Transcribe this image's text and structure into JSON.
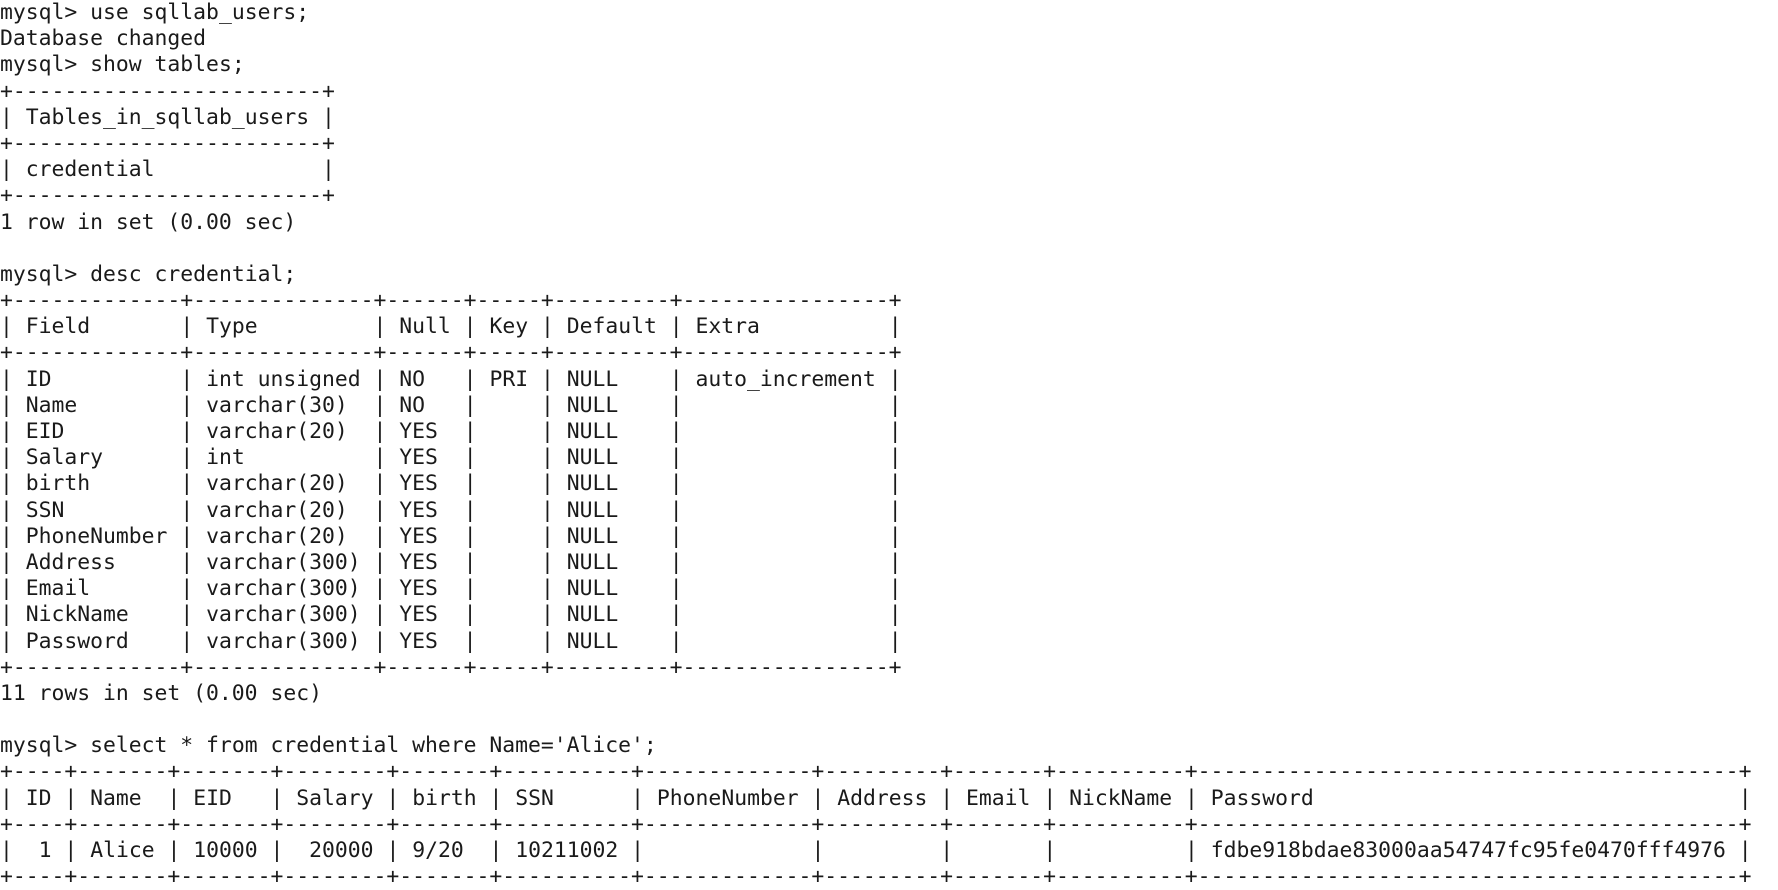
{
  "terminal": {
    "prompt": "mysql> ",
    "blocks": [
      {
        "type": "command",
        "command": "use sqllab_users;",
        "output": [
          "Database changed"
        ]
      },
      {
        "type": "query",
        "command": "show tables;",
        "table": {
          "columns": [
            {
              "name": "Tables_in_sqllab_users",
              "align": "left"
            }
          ],
          "rows": [
            [
              "credential"
            ]
          ]
        },
        "footer": "1 row in set (0.00 sec)"
      },
      {
        "type": "query",
        "command": "desc credential;",
        "table": {
          "columns": [
            {
              "name": "Field",
              "align": "left"
            },
            {
              "name": "Type",
              "align": "left"
            },
            {
              "name": "Null",
              "align": "left"
            },
            {
              "name": "Key",
              "align": "left"
            },
            {
              "name": "Default",
              "align": "left"
            },
            {
              "name": "Extra",
              "align": "left"
            }
          ],
          "rows": [
            [
              "ID",
              "int unsigned",
              "NO",
              "PRI",
              "NULL",
              "auto_increment"
            ],
            [
              "Name",
              "varchar(30)",
              "NO",
              "",
              "NULL",
              ""
            ],
            [
              "EID",
              "varchar(20)",
              "YES",
              "",
              "NULL",
              ""
            ],
            [
              "Salary",
              "int",
              "YES",
              "",
              "NULL",
              ""
            ],
            [
              "birth",
              "varchar(20)",
              "YES",
              "",
              "NULL",
              ""
            ],
            [
              "SSN",
              "varchar(20)",
              "YES",
              "",
              "NULL",
              ""
            ],
            [
              "PhoneNumber",
              "varchar(20)",
              "YES",
              "",
              "NULL",
              ""
            ],
            [
              "Address",
              "varchar(300)",
              "YES",
              "",
              "NULL",
              ""
            ],
            [
              "Email",
              "varchar(300)",
              "YES",
              "",
              "NULL",
              ""
            ],
            [
              "NickName",
              "varchar(300)",
              "YES",
              "",
              "NULL",
              ""
            ],
            [
              "Password",
              "varchar(300)",
              "YES",
              "",
              "NULL",
              ""
            ]
          ]
        },
        "footer": "11 rows in set (0.00 sec)"
      },
      {
        "type": "query",
        "command": "select * from credential where Name='Alice';",
        "table": {
          "columns": [
            {
              "name": "ID",
              "align": "right"
            },
            {
              "name": "Name",
              "align": "left"
            },
            {
              "name": "EID",
              "align": "left"
            },
            {
              "name": "Salary",
              "align": "right"
            },
            {
              "name": "birth",
              "align": "left"
            },
            {
              "name": "SSN",
              "align": "left"
            },
            {
              "name": "PhoneNumber",
              "align": "left"
            },
            {
              "name": "Address",
              "align": "left"
            },
            {
              "name": "Email",
              "align": "left"
            },
            {
              "name": "NickName",
              "align": "left"
            },
            {
              "name": "Password",
              "align": "left"
            }
          ],
          "rows": [
            [
              "1",
              "Alice",
              "10000",
              "20000",
              "9/20",
              "10211002",
              "",
              "",
              "",
              "",
              "fdbe918bdae83000aa54747fc95fe0470fff4976"
            ]
          ]
        },
        "footer": null
      }
    ]
  }
}
